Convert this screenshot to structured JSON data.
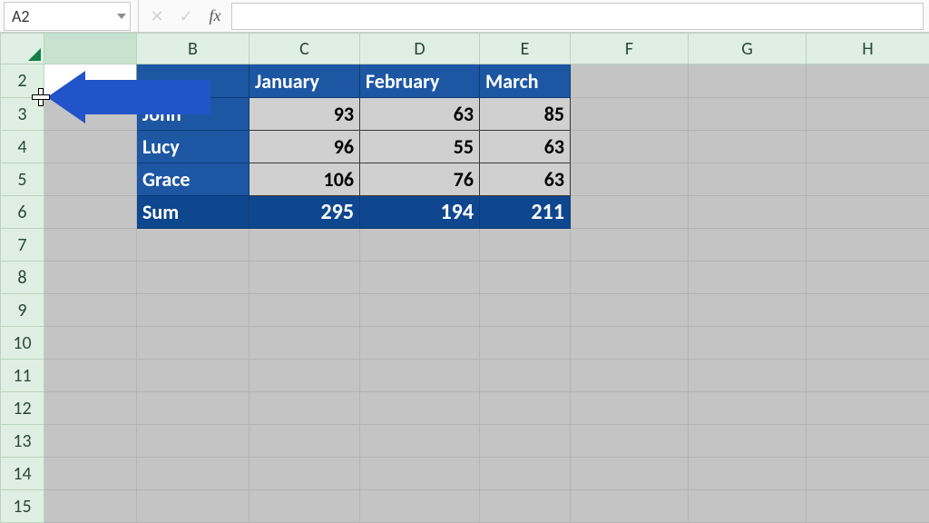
{
  "name_box": {
    "value": "A2"
  },
  "formula_bar": {
    "cancel_label": "✕",
    "confirm_label": "✓",
    "fx_label": "fx",
    "value": ""
  },
  "columns": {
    "A": "",
    "B": "B",
    "C": "C",
    "D": "D",
    "E": "E",
    "F": "F",
    "G": "G",
    "H": "H"
  },
  "rows": [
    "2",
    "3",
    "4",
    "5",
    "6",
    "7",
    "8",
    "9",
    "10",
    "11",
    "12",
    "13",
    "14",
    "15"
  ],
  "active_cell": "A2",
  "data_table": {
    "corner": "",
    "headers": [
      "January",
      "February",
      "March"
    ],
    "rows": [
      {
        "name": "John",
        "values": [
          93,
          63,
          85
        ]
      },
      {
        "name": "Lucy",
        "values": [
          96,
          55,
          63
        ]
      },
      {
        "name": "Grace",
        "values": [
          106,
          76,
          63
        ]
      }
    ],
    "sum_label": "Sum",
    "sums": [
      295,
      194,
      211
    ]
  },
  "annotation": {
    "arrow_target": "select-all-corner"
  },
  "chart_data": {
    "type": "table",
    "categories": [
      "January",
      "February",
      "March"
    ],
    "series": [
      {
        "name": "John",
        "values": [
          93,
          63,
          85
        ]
      },
      {
        "name": "Lucy",
        "values": [
          96,
          55,
          63
        ]
      },
      {
        "name": "Grace",
        "values": [
          106,
          76,
          63
        ]
      },
      {
        "name": "Sum",
        "values": [
          295,
          194,
          211
        ]
      }
    ],
    "title": "",
    "xlabel": "",
    "ylabel": ""
  }
}
